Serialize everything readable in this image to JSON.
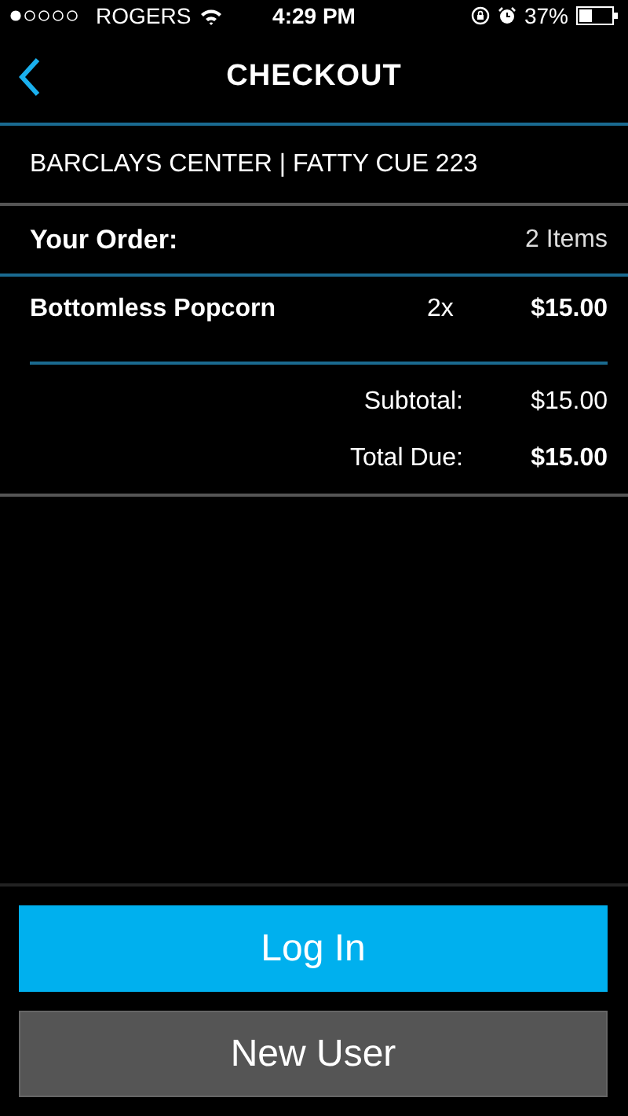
{
  "status_bar": {
    "carrier": "ROGERS",
    "time": "4:29 PM",
    "battery": "37%"
  },
  "nav": {
    "title": "CHECKOUT"
  },
  "venue": "BARCLAYS CENTER | FATTY CUE 223",
  "order": {
    "heading": "Your Order:",
    "count": "2 Items",
    "items": [
      {
        "name": "Bottomless Popcorn",
        "quantity": "2x",
        "price": "$15.00"
      }
    ],
    "totals": [
      {
        "label": "Subtotal:",
        "value": "$15.00",
        "kind": "normal"
      },
      {
        "label": "Total Due:",
        "value": "$15.00",
        "kind": "strong"
      }
    ]
  },
  "buttons": [
    {
      "label": "Log In",
      "kind": "primary"
    },
    {
      "label": "New User",
      "kind": "secondary"
    }
  ]
}
